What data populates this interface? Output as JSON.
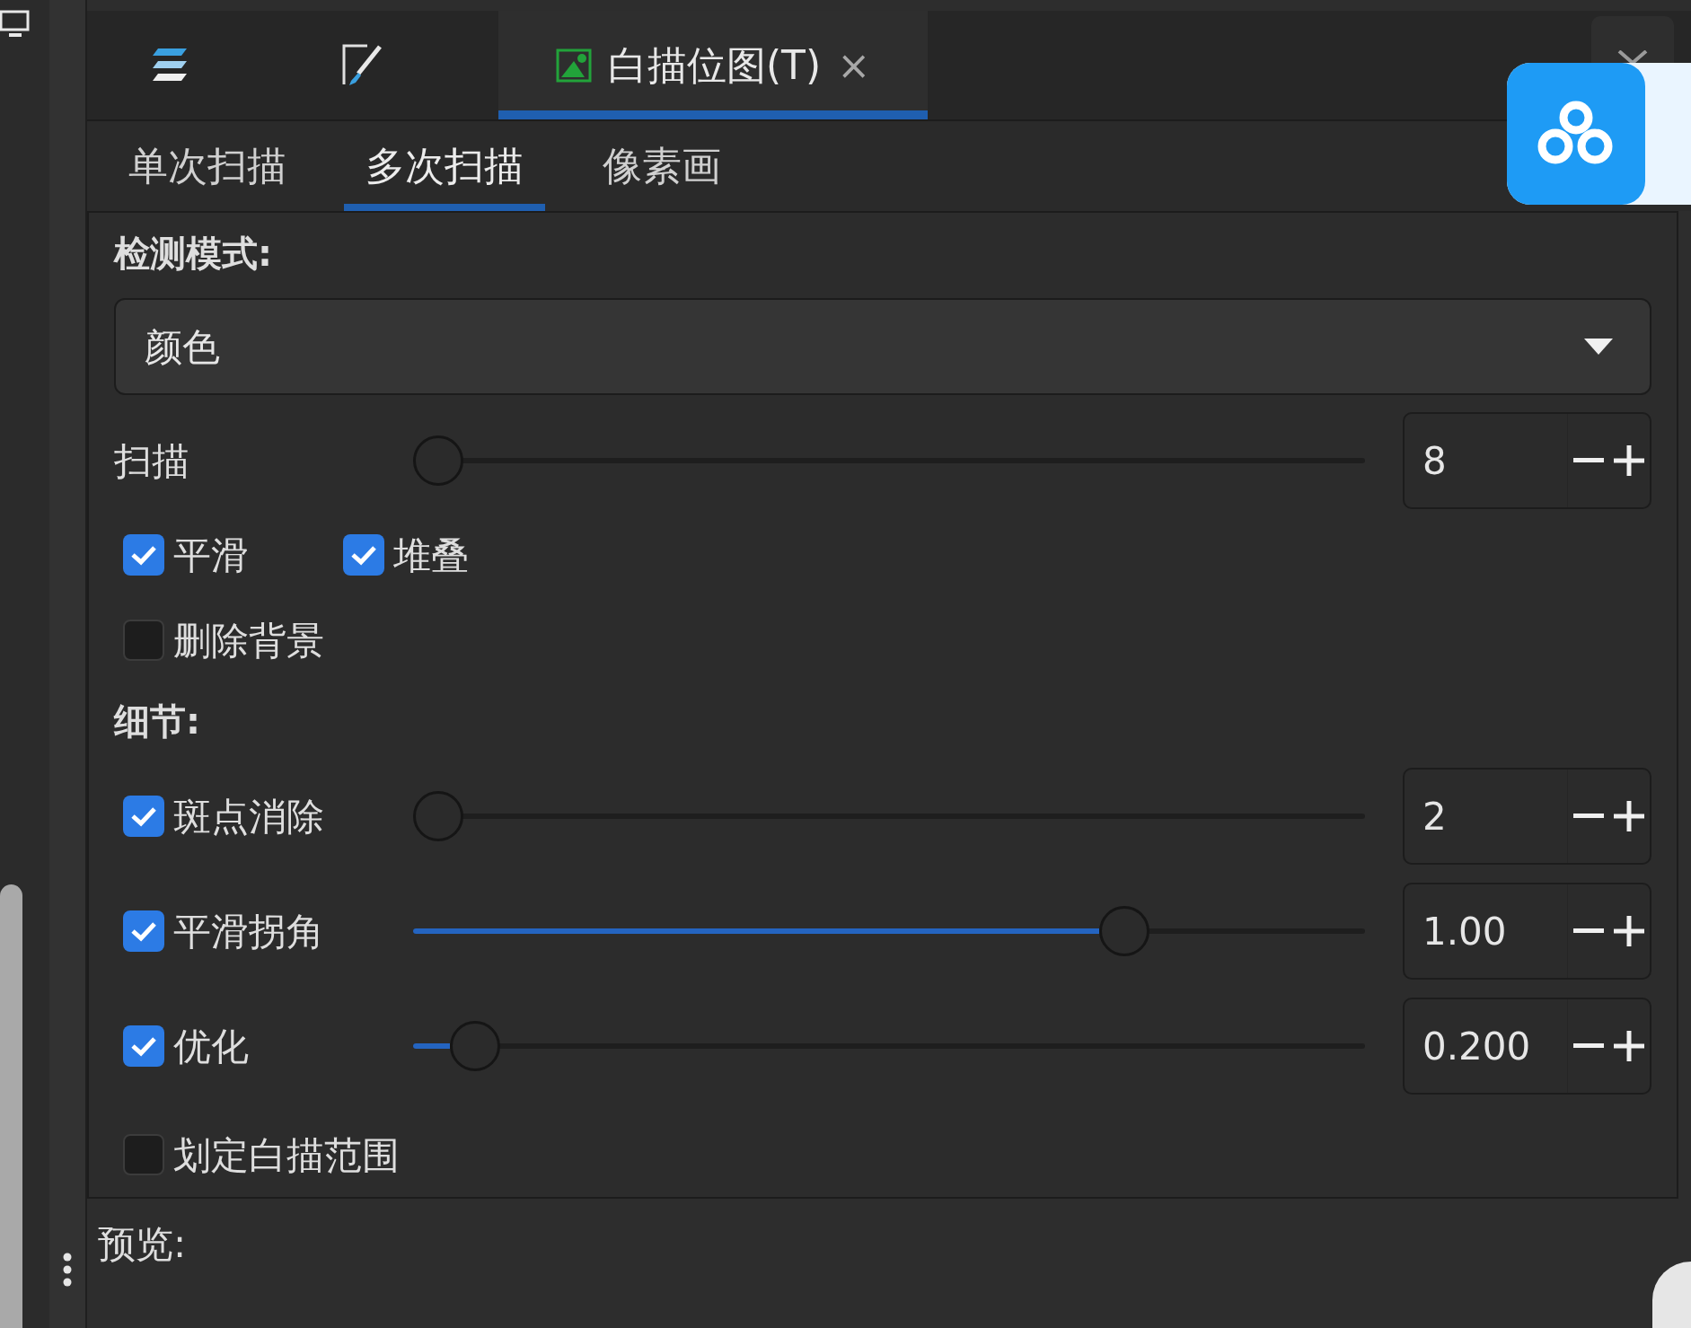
{
  "tabs": [
    {
      "kind": "layers",
      "selected": false
    },
    {
      "kind": "brush",
      "selected": false
    },
    {
      "kind": "trace",
      "label": "白描位图(T)",
      "close": "×",
      "selected": true
    }
  ],
  "subtabs": [
    {
      "label": "单次扫描",
      "selected": false
    },
    {
      "label": "多次扫描",
      "selected": true
    },
    {
      "label": "像素画",
      "selected": false
    }
  ],
  "detection_mode": {
    "label": "检测模式:",
    "value": "颜色"
  },
  "scans": {
    "label": "扫描",
    "level": 0,
    "value": "8"
  },
  "options": [
    {
      "label": "平滑",
      "checked": true
    },
    {
      "label": "堆叠",
      "checked": true
    },
    {
      "label": "删除背景",
      "checked": false
    }
  ],
  "details_label": "细节:",
  "details": [
    {
      "kind": "slider",
      "label": "斑点消除",
      "checked": true,
      "level": 0,
      "value": "2"
    },
    {
      "kind": "slider",
      "label": "平滑拐角",
      "checked": true,
      "level": 0.74,
      "value": "1.00"
    },
    {
      "kind": "slider",
      "label": "优化",
      "checked": true,
      "level": 0.04,
      "value": "0.200"
    },
    {
      "kind": "checkbox",
      "label": "划定白描范围",
      "checked": false
    }
  ],
  "preview_label": "预览:"
}
